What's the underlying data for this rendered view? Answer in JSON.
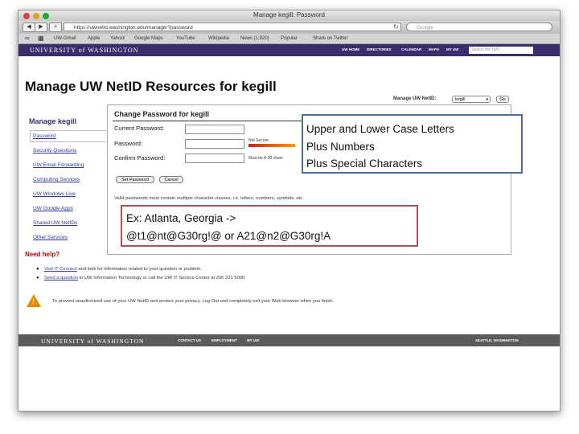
{
  "browser": {
    "window_title": "Manage kegill: Password",
    "url": "https://uwnetid.washington.edu/manage/?password",
    "search_placeholder": "Google",
    "bookmarks": [
      "UW-Gmail",
      "Apple",
      "Yahoo!",
      "Google Maps",
      "YouTube",
      "Wikipedia",
      "News (1,920)",
      "Popular",
      "Share on Twitter"
    ]
  },
  "uw_header": {
    "logo": "UNIVERSITY of WASHINGTON",
    "links": [
      "UW HOME",
      "DIRECTORIES",
      "CALENDAR",
      "MAPS",
      "MY UW"
    ],
    "search_placeholder": "Search the UW"
  },
  "page": {
    "title": "Manage UW NetID Resources for kegill",
    "netid_label": "Manage UW NetID:",
    "netid_value": "kegill",
    "go_label": "Go"
  },
  "sidebar": {
    "title": "Manage kegill",
    "items": [
      "Password",
      "Security Questions",
      "UW Email Forwarding",
      "Computing Services",
      "UW Windows Live",
      "UW Google Apps",
      "Shared UW NetIDs",
      "Other Services"
    ]
  },
  "panel": {
    "title": "Change Password for kegill",
    "current_label": "Current Password:",
    "password_label": "Password:",
    "confirm_label": "Confirm Password:",
    "strength": "Not Secure",
    "length_hint": "Must be 8-30 chars",
    "set_button": "Set Password",
    "cancel_button": "Cancel",
    "hint": "Valid passwords must contain multiple character classes, i.e. letters, numbers, symbols, etc."
  },
  "help": {
    "title": "Need help?",
    "line1_link": "Visit IT Connect",
    "line1_text": " and look for information related to your question or problem.",
    "line2_link": "Send a question",
    "line2_text": " to UW Information Technology or call the UW IT Service Center at 206 221 5000.",
    "warning": "To prevent unauthorized use of your UW NetID and protect your privacy, Log Out and completely exit your Web browser when you finish."
  },
  "footer": {
    "logo": "UNIVERSITY of WASHINGTON",
    "links": [
      "CONTACT US",
      "EMPLOYMENT",
      "MY UW"
    ],
    "location": "SEATTLE, WASHINGTON"
  },
  "callouts": {
    "rules": [
      "Upper and Lower Case Letters",
      "Plus Numbers",
      "Plus Special Characters"
    ],
    "example_line1": "Ex: Atlanta, Georgia ->",
    "example_line2": "@t1@nt@G30rg!@ or A21@n2@G30rg!A"
  },
  "colors": {
    "uw_purple": "#3b2d6b",
    "help_red": "#cc0000",
    "callout_blue": "#4a6fa5",
    "callout_red": "#b05050"
  }
}
